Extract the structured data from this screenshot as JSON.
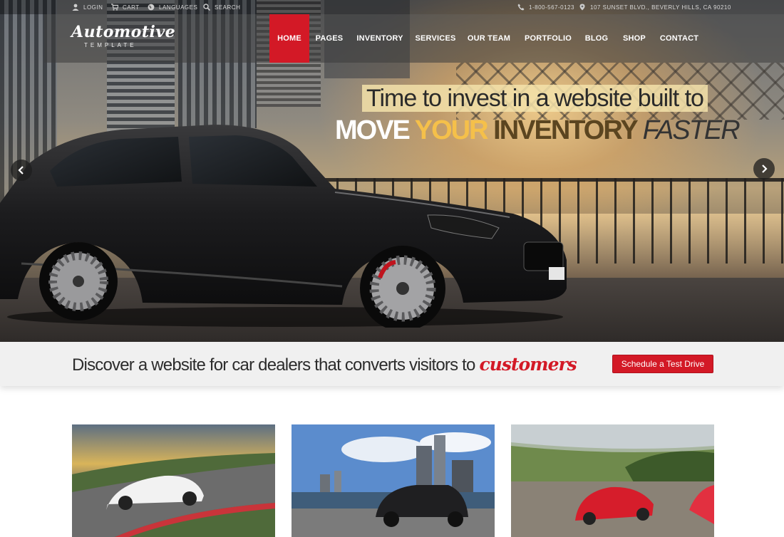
{
  "topbar": {
    "login": "LOGIN",
    "cart": "CART",
    "languages": "LANGUAGES",
    "search": "SEARCH",
    "phone": "1-800-567-0123",
    "address": "107 SUNSET BLVD., BEVERLY HILLS, CA 90210"
  },
  "logo": {
    "main": "Automotive",
    "sub": "TEMPLATE"
  },
  "nav": {
    "items": [
      "HOME",
      "PAGES",
      "INVENTORY",
      "SERVICES",
      "OUR TEAM",
      "PORTFOLIO",
      "BLOG",
      "SHOP",
      "CONTACT"
    ],
    "active": "HOME"
  },
  "hero": {
    "line1": "Time to invest in a website built to",
    "line2_a": "MOVE ",
    "line2_b": "YOUR ",
    "line2_c": "INVENTORY ",
    "line2_d": "FASTER"
  },
  "promo": {
    "text": "Discover a website for car dealers that converts visitors to ",
    "accent": "customers",
    "cta": "Schedule a Test Drive"
  },
  "colors": {
    "accent": "#d31926",
    "highlight": "#f5c04a"
  },
  "icons": {
    "login": "user-icon",
    "cart": "cart-icon",
    "languages": "globe-icon",
    "search": "search-icon",
    "phone": "phone-icon",
    "address": "map-pin-icon",
    "prev": "chevron-left-icon",
    "next": "chevron-right-icon"
  }
}
